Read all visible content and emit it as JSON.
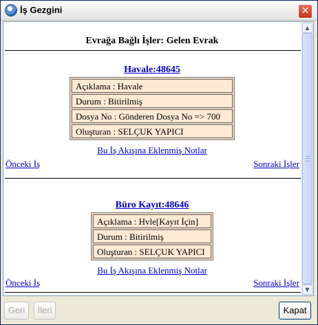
{
  "window": {
    "title": "İş Gezgini"
  },
  "page": {
    "heading": "Evrağa Bağlı İşler: Gelen Evrak"
  },
  "items": [
    {
      "title": "Havale:48645",
      "fields": [
        "Açıklama : Havale",
        "Durum : Bitirilmiş",
        "Dosya No : Gönderen Dosya No => 700",
        "Oluşturan : SELÇUK YAPICI"
      ],
      "notes_link": "Bu İş Akışına Eklenmiş Notlar",
      "prev_link": "Önceki İş",
      "next_link": "Sonraki İşler"
    },
    {
      "title": "Büro Kayıt:48646",
      "fields": [
        "Açıklama : Hvle[Kayıt İçin]",
        "Durum : Bitirilmiş",
        "Oluşturan : SELÇUK YAPICI"
      ],
      "notes_link": "Bu İş Akışına Eklenmiş Notlar",
      "prev_link": "Önceki İş",
      "next_link": "Sonraki İşler"
    }
  ],
  "buttons": {
    "back": "Geri",
    "forward": "İleri",
    "close": "Kapat"
  },
  "icons": {
    "app": "app-icon",
    "close": "close-icon"
  }
}
